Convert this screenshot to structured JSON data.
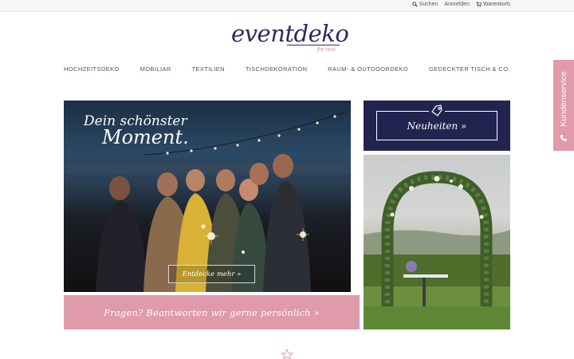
{
  "topbar": {
    "search_label": "Suchen",
    "login_label": "Anmelden",
    "cart_label": "Warenkorb"
  },
  "logo": {
    "wordmark": "eventdeko",
    "tagline": "for rent"
  },
  "nav": {
    "items": [
      {
        "label": "HOCHZEITSDEKO"
      },
      {
        "label": "MOBILIAR"
      },
      {
        "label": "TEXTILIEN"
      },
      {
        "label": "TISCHDEKORATION"
      },
      {
        "label": "RAUM- & OUTDOORDEKO"
      },
      {
        "label": "GEDECKTER TISCH & CO."
      }
    ]
  },
  "hero": {
    "title_line1": "Dein schönster",
    "title_line2": "Moment.",
    "button_label": "Entdecke mehr »"
  },
  "faq": {
    "label": "Fragen? Beantworten wir gerne persönlich »"
  },
  "news": {
    "label": "Neuheiten »",
    "icon": "tag-icon"
  },
  "side_tab": {
    "label": "Kundenservice",
    "icon": "phone-icon"
  },
  "icons": {
    "search": "search-icon",
    "cart": "cart-icon",
    "divider": "star-outline-icon"
  },
  "colors": {
    "navy": "#22234f",
    "pink": "#df9aac",
    "logo_navy": "#2a2c5c"
  }
}
